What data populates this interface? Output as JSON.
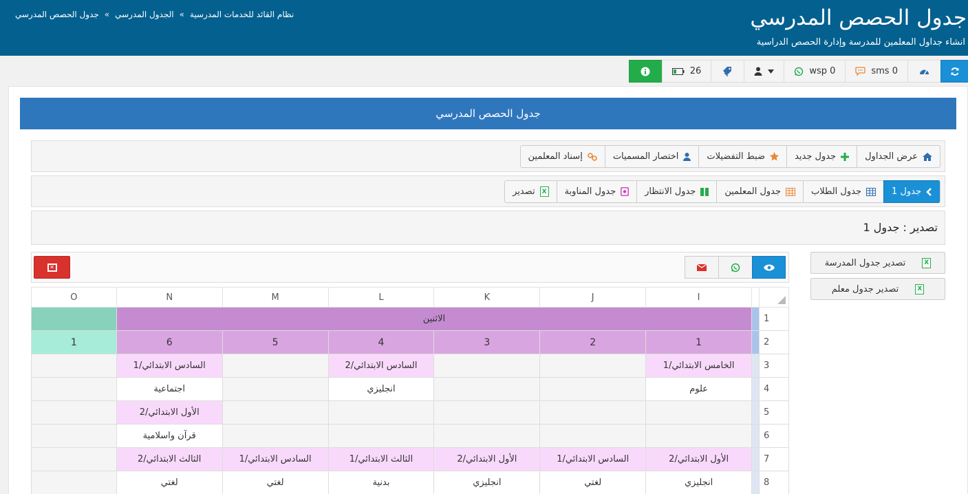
{
  "header": {
    "title": "جدول الحصص المدرسي",
    "subtitle": "انشاء جداول المعلمين للمدرسة وإدارة الحصص الدراسية",
    "breadcrumb": [
      "نظام القائد للخدمات المدرسية",
      "الجدول المدرسي",
      "جدول الحصص المدرسي"
    ],
    "breadcrumb_sep": "»"
  },
  "toolbar": {
    "sms_label": "sms 0",
    "wsp_label": "wsp 0",
    "battery_label": "26"
  },
  "panel": {
    "title": "جدول الحصص المدرسي"
  },
  "nav1": [
    {
      "label": "عرض الجداول",
      "icon": "home-icon"
    },
    {
      "label": "جدول جديد",
      "icon": "plus-icon"
    },
    {
      "label": "ضبط التفضيلات",
      "icon": "star-icon"
    },
    {
      "label": "اختصار المسميات",
      "icon": "user-icon"
    },
    {
      "label": "إسناد المعلمين",
      "icon": "link-icon"
    }
  ],
  "nav2": [
    {
      "label": "جدول 1",
      "icon": "chevron-left-icon",
      "active": true
    },
    {
      "label": "جدول الطلاب",
      "icon": "grid-icon"
    },
    {
      "label": "جدول المعلمين",
      "icon": "table-icon"
    },
    {
      "label": "جدول الانتظار",
      "icon": "columns-icon"
    },
    {
      "label": "جدول المناوبة",
      "icon": "shield-icon"
    },
    {
      "label": "تصدير",
      "icon": "excel-icon"
    }
  ],
  "export": {
    "title": "تصدير : جدول 1",
    "school_btn": "تصدير جدول المدرسة",
    "teacher_btn": "تصدير جدول معلم"
  },
  "sheet": {
    "columns": [
      "O",
      "N",
      "M",
      "L",
      "K",
      "J",
      "I"
    ],
    "day": "الاثنين",
    "periods": [
      "1",
      "6",
      "5",
      "4",
      "3",
      "2",
      "1"
    ],
    "rows": [
      {
        "num": "1"
      },
      {
        "num": "2"
      },
      {
        "num": "3",
        "cells": [
          "",
          "السادس الابتدائي/1",
          "",
          "السادس الابتدائي/2",
          "",
          "",
          "الخامس الابتدائي/1"
        ]
      },
      {
        "num": "4",
        "cells": [
          "",
          "اجتماعية",
          "",
          "انجليزي",
          "",
          "",
          "علوم"
        ]
      },
      {
        "num": "5",
        "cells": [
          "",
          "الأول الابتدائي/2",
          "",
          "",
          "",
          "",
          ""
        ]
      },
      {
        "num": "6",
        "cells": [
          "",
          "قرآن واسلامية",
          "",
          "",
          "",
          "",
          ""
        ]
      },
      {
        "num": "7",
        "cells": [
          "",
          "الثالث الابتدائي/2",
          "السادس الابتدائي/1",
          "الثالث الابتدائي/1",
          "الأول الابتدائي/2",
          "السادس الابتدائي/1",
          "الأول الابتدائي/2"
        ]
      },
      {
        "num": "8",
        "cells": [
          "",
          "لغتي",
          "لغتي",
          "بدنية",
          "انجليزي",
          "لغتي",
          "انجليزي"
        ]
      }
    ]
  },
  "colors": {
    "header_bg": "#04608f",
    "panel_head": "#2f77bd",
    "accent_blue": "#1a90d6",
    "green": "#23ad4a",
    "red": "#d9312c",
    "day_bg": "#c58bd0",
    "period_bg": "#d9a5e0",
    "class_bg": "#f9d9fb",
    "mint": "#a6ecd8"
  }
}
